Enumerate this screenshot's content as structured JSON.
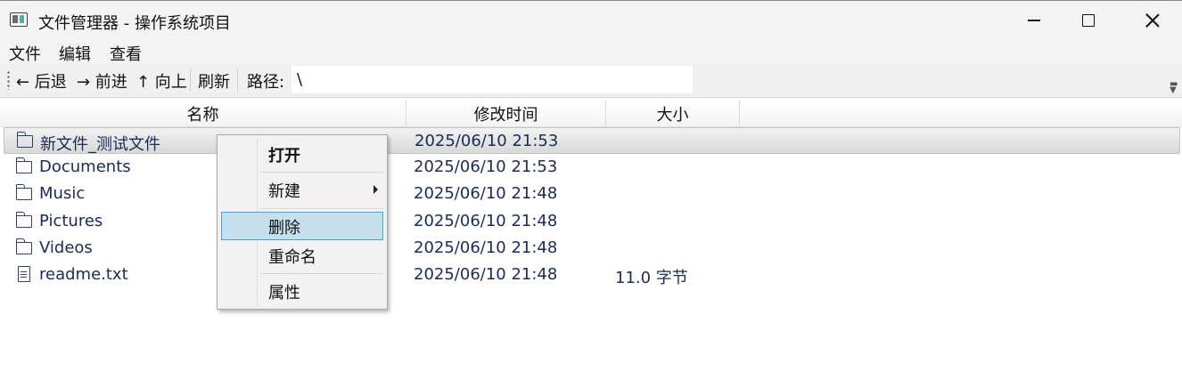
{
  "window": {
    "title": "文件管理器 - 操作系统项目"
  },
  "menubar": {
    "items": [
      "文件",
      "编辑",
      "查看"
    ]
  },
  "toolbar": {
    "back": "← 后退",
    "forward": "→ 前进",
    "up": "↑ 向上",
    "refresh": "刷新",
    "path_label": "路径:",
    "path_value": "\\"
  },
  "columns": [
    "名称",
    "修改时间",
    "大小"
  ],
  "files": [
    {
      "name": "新文件_测试文件",
      "modified": "2025/06/10 21:53",
      "size": "",
      "icon": "folder-icon"
    },
    {
      "name": "Documents",
      "modified": "2025/06/10 21:53",
      "size": "",
      "icon": "folder-icon"
    },
    {
      "name": "Music",
      "modified": "2025/06/10 21:48",
      "size": "",
      "icon": "folder-icon"
    },
    {
      "name": "Pictures",
      "modified": "2025/06/10 21:48",
      "size": "",
      "icon": "folder-icon"
    },
    {
      "name": "Videos",
      "modified": "2025/06/10 21:48",
      "size": "",
      "icon": "folder-icon"
    },
    {
      "name": "readme.txt",
      "modified": "2025/06/10 21:48",
      "size": "11.0 字节",
      "icon": "file-icon"
    }
  ],
  "context_menu": {
    "open": "打开",
    "new": "新建",
    "delete": "删除",
    "rename": "重命名",
    "properties": "属性"
  },
  "colors": {
    "selection_hover": "#c5dfec",
    "selection_border": "#3ea7e0",
    "file_text": "#1a2a5a"
  }
}
